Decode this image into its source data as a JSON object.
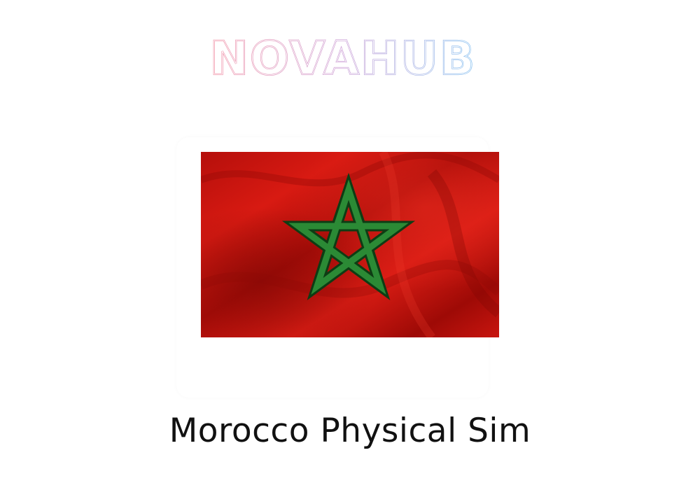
{
  "brand": {
    "name": "NOVAHUB",
    "gradient": [
      "#f28ba0",
      "#c99ad4",
      "#7dbdf0"
    ]
  },
  "product": {
    "title": "Morocco Physical Sim",
    "image": {
      "icon": "morocco-flag-icon",
      "flag_red": "#c1140f",
      "star_green": "#1f7a2c"
    }
  }
}
